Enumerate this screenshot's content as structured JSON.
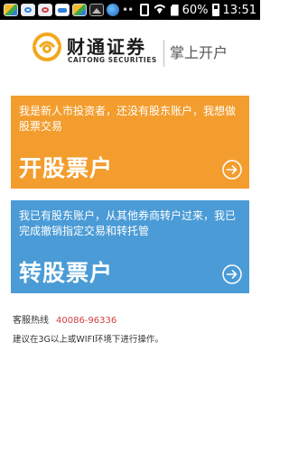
{
  "status_bar": {
    "time": "13:51",
    "battery_percent": "60%",
    "notification_icons": [
      "app-icon",
      "app-icon",
      "app-icon",
      "app-icon",
      "app-icon",
      "image-icon",
      "globe-icon"
    ],
    "overflow": "••"
  },
  "header": {
    "brand_name": "财通证券",
    "brand_english": "CAITONG SECURITIES",
    "tagline": "掌上开户"
  },
  "cards": [
    {
      "id": "open",
      "description": "我是新人市投资者，还没有股东账户，我想做股票交易",
      "title": "开股票户",
      "color": "#f39d2e"
    },
    {
      "id": "transfer",
      "description": "我已有股东账户，从其他券商转户过来，我已完成撤销指定交易和转托管",
      "title": "转股票户",
      "color": "#4a9bd6"
    }
  ],
  "info": {
    "hotline_label": "客服热线",
    "hotline_number": "40086-96336",
    "tip": "建议在3G以上或WIFI环境下进行操作。"
  },
  "colors": {
    "logo": "#f2a81d",
    "hotline_number": "#d04040"
  }
}
